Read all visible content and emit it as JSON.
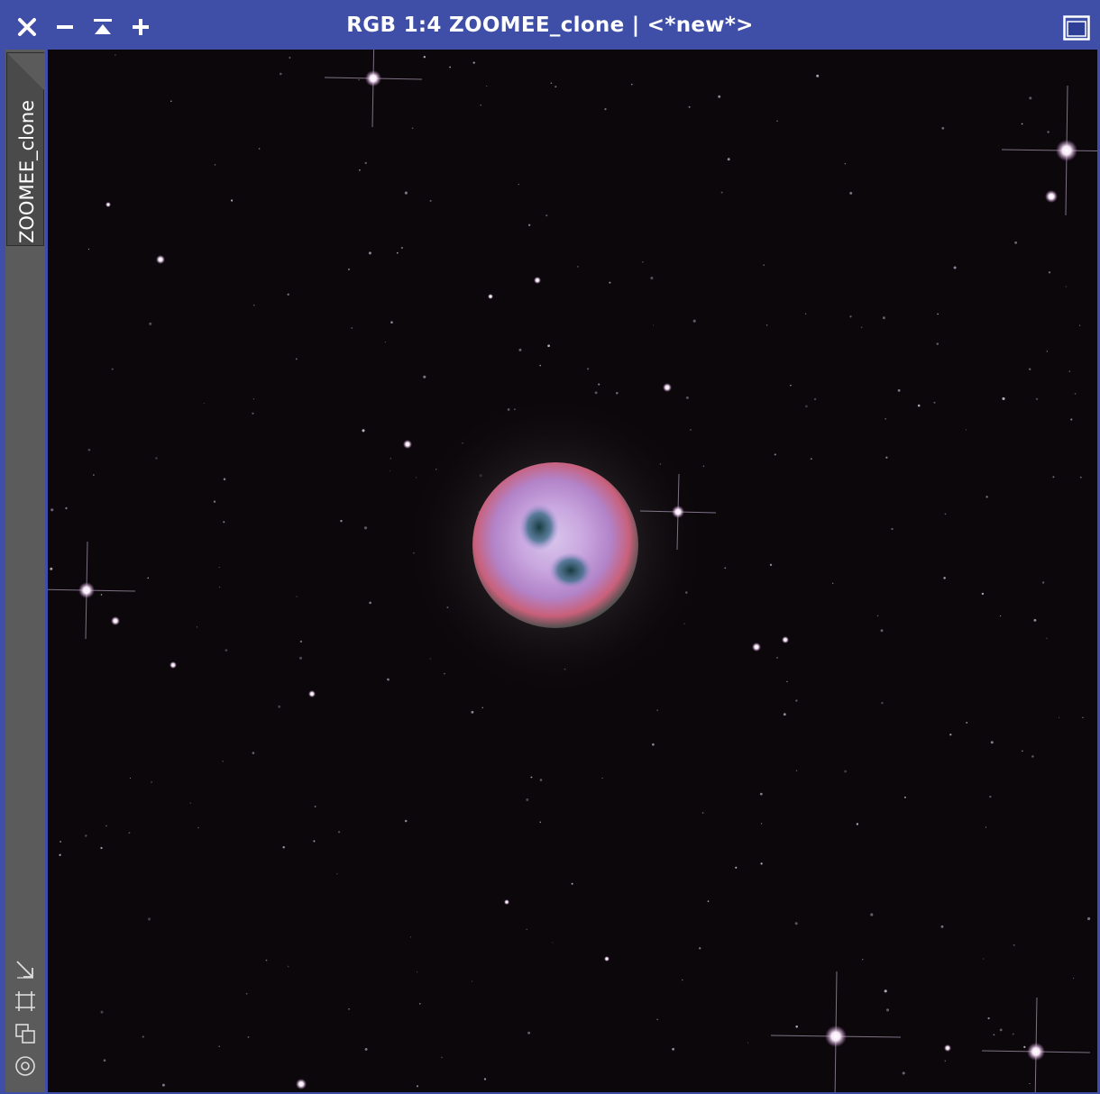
{
  "window": {
    "title": "RGB 1:4 ZOOMEE_clone | <*new*>",
    "accent_color": "#3f4fa8"
  },
  "titlebar": {
    "buttons": [
      {
        "icon": "close-icon"
      },
      {
        "icon": "minimize-icon"
      },
      {
        "icon": "shade-icon"
      },
      {
        "icon": "zoom-in-icon"
      }
    ],
    "maximize_icon": "maximize-icon"
  },
  "sidebar": {
    "tab_label": "ZOOMEE_clone",
    "tools": [
      {
        "icon": "fit-view-icon"
      },
      {
        "icon": "crop-frame-icon"
      },
      {
        "icon": "clone-icon"
      },
      {
        "icon": "target-icon"
      }
    ]
  },
  "image": {
    "subject": "nebula-image",
    "background_color": "#0b070b"
  }
}
